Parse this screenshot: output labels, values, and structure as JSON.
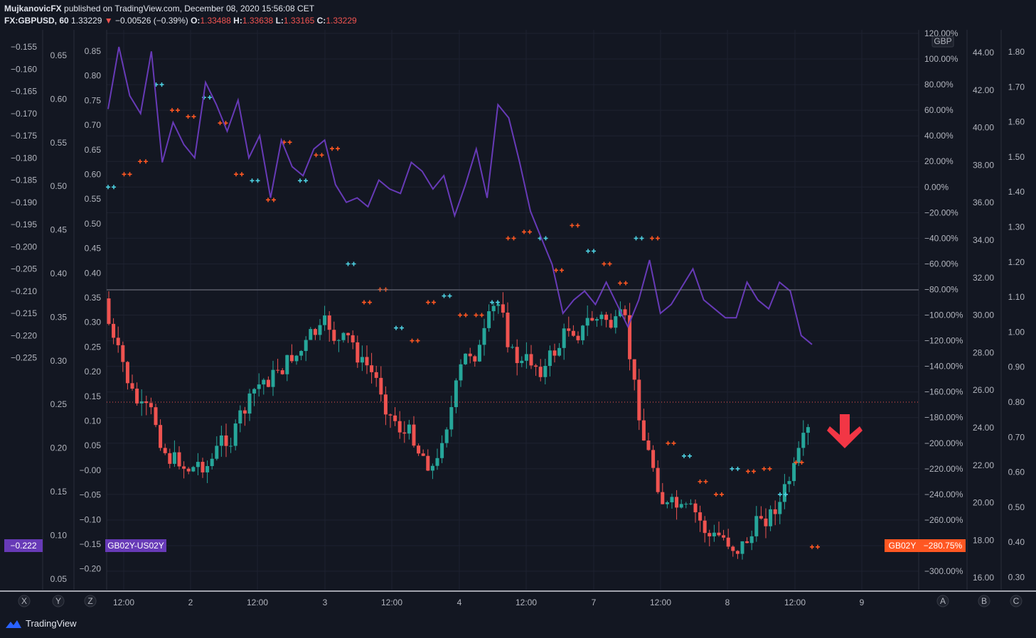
{
  "header": {
    "publisher": "MujkanovicFX",
    "published_text": "published on TradingView.com, December 08, 2020 15:56:08 CET",
    "symbol": "FX:GBPUSD, 60",
    "last": "1.33229",
    "change": "−0.00526 (−0.39%)",
    "o_label": "O:",
    "o_val": "1.33488",
    "h_label": "H:",
    "h_val": "1.33638",
    "l_label": "L:",
    "l_val": "1.33165",
    "c_label": "C:",
    "c_val": "1.33229"
  },
  "footer": {
    "brand": "TradingView"
  },
  "axis_buttons": {
    "x": "X",
    "y": "Y",
    "z": "Z",
    "a": "A",
    "b": "B",
    "c": "C"
  },
  "tags": {
    "left_value": "−0.222",
    "spread_label": "GB02Y-US02Y",
    "right_label": "GB02Y",
    "right_value": "−280.75%"
  },
  "currency_badge": "GBP",
  "colors": {
    "background": "#131722",
    "bull": "#26a69a",
    "bear": "#ef5350",
    "spread_line": "#673ab7",
    "cyan_marks": "#4dd0e1",
    "orange_marks": "#ff5722",
    "arrow": "#f23645"
  },
  "chart_data": {
    "type": "line",
    "title": "",
    "x_ticks": [
      "12:00",
      "2",
      "12:00",
      "3",
      "12:00",
      "4",
      "12:00",
      "7",
      "12:00",
      "8",
      "12:00",
      "9"
    ],
    "y_axes": {
      "axis_x": [
        "−0.155",
        "−0.160",
        "−0.165",
        "−0.170",
        "−0.175",
        "−0.180",
        "−0.185",
        "−0.190",
        "−0.195",
        "−0.200",
        "−0.205",
        "−0.210",
        "−0.215",
        "−0.220",
        "−0.225"
      ],
      "axis_y": [
        "0.65",
        "0.60",
        "0.55",
        "0.50",
        "0.45",
        "0.40",
        "0.35",
        "0.30",
        "0.25",
        "0.20",
        "0.15",
        "0.10",
        "0.05"
      ],
      "axis_z": [
        "0.85",
        "0.80",
        "0.75",
        "0.70",
        "0.65",
        "0.60",
        "0.55",
        "0.50",
        "0.45",
        "0.40",
        "0.35",
        "0.30",
        "0.25",
        "0.20",
        "0.15",
        "0.10",
        "0.05",
        "−0.00",
        "−0.05",
        "−0.10",
        "−0.15",
        "−0.20"
      ],
      "axis_a": [
        "120.00%",
        "100.00%",
        "80.00%",
        "60.00%",
        "40.00%",
        "20.00%",
        "0.00%",
        "−20.00%",
        "−40.00%",
        "−60.00%",
        "−80.00%",
        "−100.00%",
        "−120.00%",
        "−140.00%",
        "−160.00%",
        "−180.00%",
        "−200.00%",
        "−220.00%",
        "−240.00%",
        "−260.00%",
        "−280.00%",
        "−300.00%"
      ],
      "axis_b": [
        "44.00",
        "42.00",
        "40.00",
        "38.00",
        "36.00",
        "34.00",
        "32.00",
        "30.00",
        "28.00",
        "26.00",
        "24.00",
        "22.00",
        "20.00",
        "18.00",
        "16.00"
      ],
      "axis_c": [
        "1.80",
        "1.70",
        "1.60",
        "1.50",
        "1.40",
        "1.30",
        "1.20",
        "1.10",
        "1.00",
        "0.90",
        "0.80",
        "0.70",
        "0.60",
        "0.50",
        "0.40",
        "0.30"
      ]
    },
    "percent_axis_range": [
      -300,
      120
    ],
    "series": [
      {
        "name": "GB02Y-US02Y",
        "type": "line",
        "axis": "axis_x",
        "x": [
          0,
          2,
          4,
          6,
          8,
          10,
          12,
          14,
          16,
          18,
          20,
          22,
          24,
          26,
          28,
          30,
          32,
          34,
          36,
          38,
          40,
          42,
          44,
          46,
          48,
          50,
          52,
          54,
          56,
          58,
          60,
          62,
          64,
          66,
          68,
          70,
          72,
          74,
          76,
          78,
          80,
          82,
          84,
          86,
          88,
          90,
          92,
          94,
          96,
          98,
          100,
          102,
          104,
          106,
          108,
          110,
          112,
          114,
          116,
          118,
          120,
          122,
          124,
          126,
          128,
          130
        ],
        "values": [
          -0.169,
          -0.155,
          -0.166,
          -0.17,
          -0.156,
          -0.181,
          -0.172,
          -0.177,
          -0.18,
          -0.163,
          -0.168,
          -0.174,
          -0.167,
          -0.18,
          -0.175,
          -0.189,
          -0.176,
          -0.182,
          -0.184,
          -0.178,
          -0.176,
          -0.186,
          -0.19,
          -0.189,
          -0.191,
          -0.185,
          -0.187,
          -0.188,
          -0.181,
          -0.183,
          -0.187,
          -0.184,
          -0.193,
          -0.186,
          -0.178,
          -0.189,
          -0.168,
          -0.171,
          -0.181,
          -0.192,
          -0.198,
          -0.204,
          -0.215,
          -0.212,
          -0.21,
          -0.213,
          -0.208,
          -0.213,
          -0.218,
          -0.212,
          -0.203,
          -0.215,
          -0.213,
          -0.209,
          -0.205,
          -0.212,
          -0.214,
          -0.216,
          -0.216,
          -0.208,
          -0.212,
          -0.214,
          -0.208,
          -0.21,
          -0.22,
          -0.222
        ]
      },
      {
        "name": "GB02Y",
        "type": "markers",
        "axis": "axis_a",
        "x": [
          0,
          3,
          6,
          9,
          12,
          15,
          18,
          21,
          24,
          27,
          30,
          33,
          36,
          39,
          42,
          45,
          48,
          51,
          54,
          57,
          60,
          63,
          66,
          69,
          72,
          75,
          78,
          81,
          84,
          87,
          90,
          93,
          96,
          99,
          102,
          105,
          108,
          111,
          114,
          117,
          120,
          123,
          126,
          129,
          132
        ],
        "values": [
          0,
          10,
          20,
          80,
          60,
          55,
          70,
          50,
          10,
          5,
          -10,
          35,
          5,
          25,
          30,
          -60,
          -90,
          -80,
          -110,
          -120,
          -90,
          -85,
          -100,
          -100,
          -90,
          -40,
          -35,
          -40,
          -65,
          -30,
          -50,
          -60,
          -75,
          -40,
          -40,
          -200,
          -210,
          -230,
          -240,
          -220,
          -222,
          -220,
          -240,
          -215,
          -281
        ]
      }
    ],
    "candles_note": "GBPUSD hourly candles, last close 1.33229"
  }
}
